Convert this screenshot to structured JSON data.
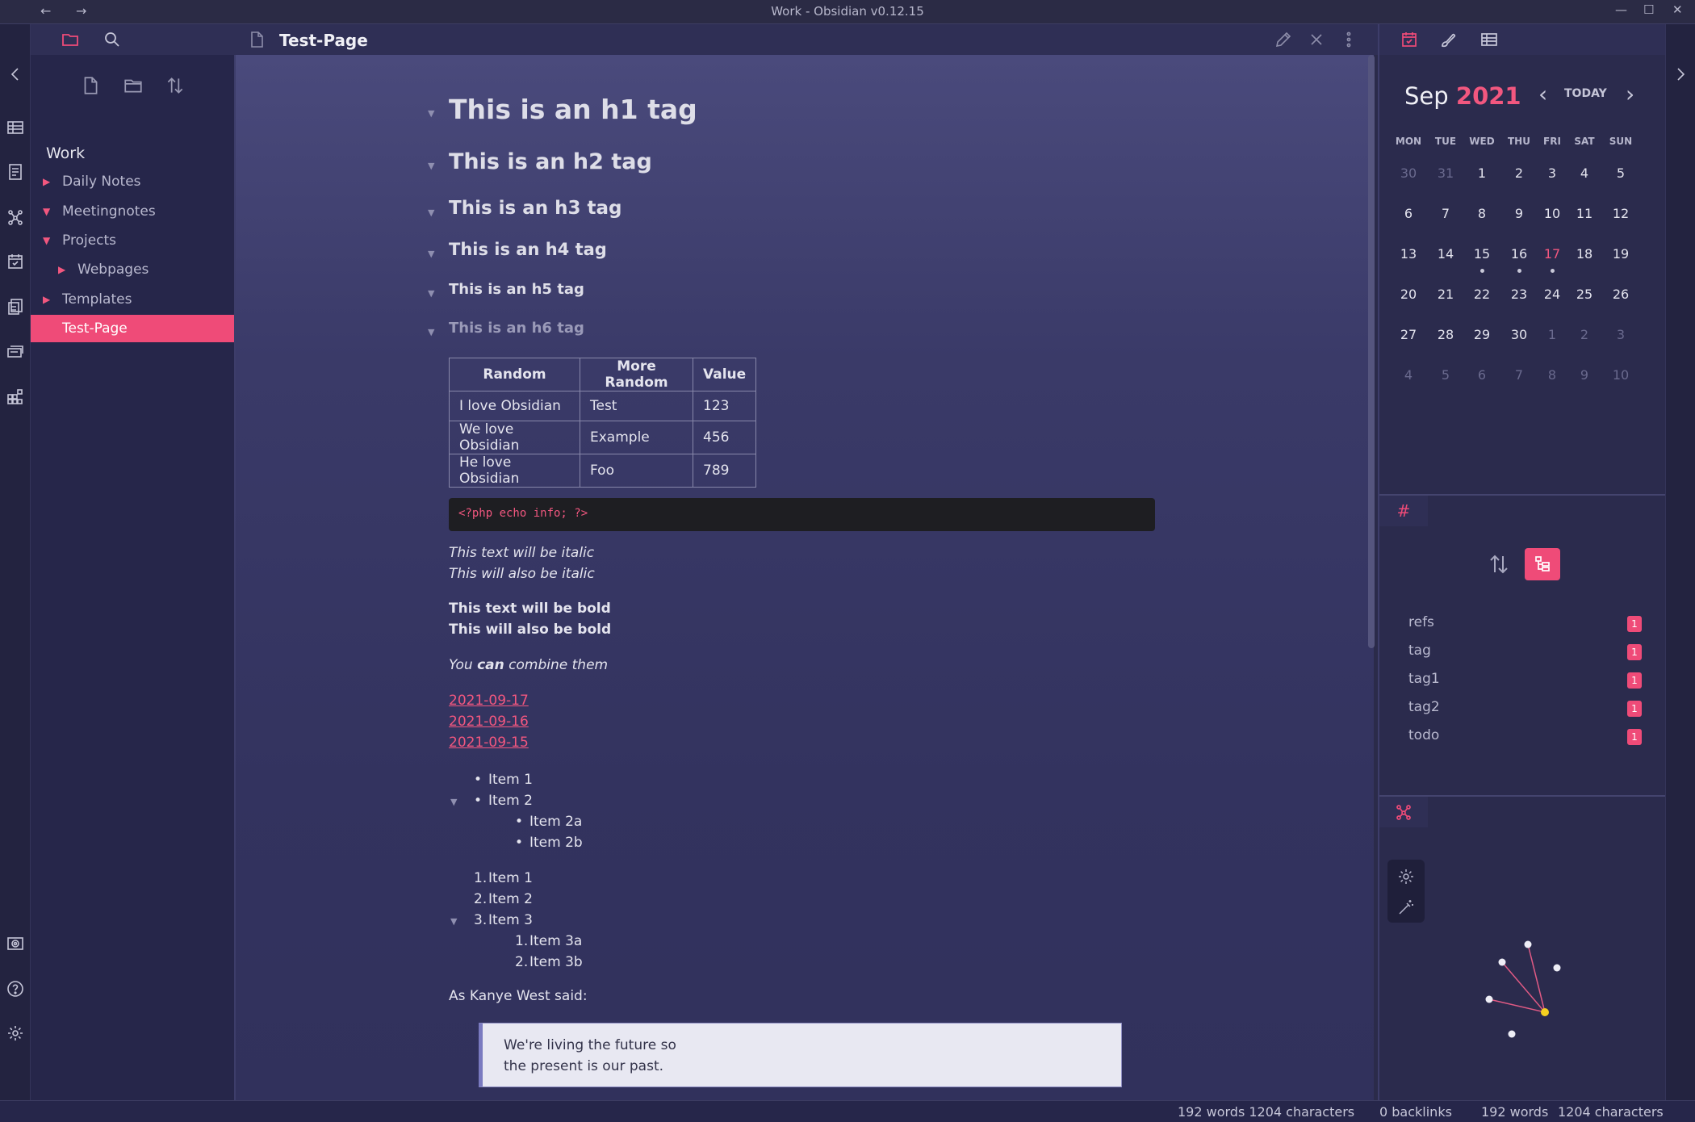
{
  "window": {
    "title": "Work - Obsidian v0.12.15",
    "back_glyph": "←",
    "forward_glyph": "→",
    "minimize_glyph": "—",
    "maximize_glyph": "☐",
    "close_glyph": "✕"
  },
  "explorer": {
    "vault_name": "Work",
    "items": [
      {
        "label": "Daily Notes",
        "arrow": "▶"
      },
      {
        "label": "Meetingnotes",
        "arrow": "▼"
      },
      {
        "label": "Projects",
        "arrow": "▼"
      },
      {
        "label": "Webpages",
        "arrow": "▶"
      },
      {
        "label": "Templates",
        "arrow": "▶"
      },
      {
        "label": "Test-Page",
        "arrow": ""
      }
    ]
  },
  "editor": {
    "file_title": "Test-Page",
    "headings": [
      "This is an h1 tag",
      "This is an h2 tag",
      "This is an h3 tag",
      "This is an h4 tag",
      "This is an h5 tag",
      "This is an h6 tag"
    ],
    "fold_glyph": "▼",
    "table": {
      "headers": [
        "Random",
        "More Random",
        "Value"
      ],
      "rows": [
        [
          "I love Obsidian",
          "Test",
          "123"
        ],
        [
          "We love Obsidian",
          "Example",
          "456"
        ],
        [
          "He love Obsidian",
          "Foo",
          "789"
        ]
      ]
    },
    "code": "<?php echo info; ?>",
    "italic_1": "This text will be italic",
    "italic_2": "This will also be italic",
    "bold_1": "This text will be bold",
    "bold_2": "This will also be bold",
    "combine_before": "You ",
    "combine_strong": "can",
    "combine_after": " combine them",
    "links": [
      "2021-09-17",
      "2021-09-16",
      "2021-09-15"
    ],
    "bullet_glyph": "•",
    "bullets": [
      "Item 1",
      "Item 2",
      "Item 2a",
      "Item 2b"
    ],
    "numbered": [
      {
        "num": "1.",
        "label": "Item 1"
      },
      {
        "num": "2.",
        "label": "Item 2"
      },
      {
        "num": "3.",
        "label": "Item 3"
      },
      {
        "num": "1.",
        "label": "Item 3a"
      },
      {
        "num": "2.",
        "label": "Item 3b"
      }
    ],
    "quote_intro": "As Kanye West said:",
    "quote_line1": "We're living the future so",
    "quote_line2": "the present is our past."
  },
  "calendar": {
    "month": "Sep",
    "year": "2021",
    "today_label": "TODAY",
    "prev_glyph": "‹",
    "next_glyph": "›",
    "weekdays": [
      "MON",
      "TUE",
      "WED",
      "THU",
      "FRI",
      "SAT",
      "SUN"
    ],
    "weeks": [
      [
        "30",
        "31",
        "1",
        "2",
        "3",
        "4",
        "5"
      ],
      [
        "6",
        "7",
        "8",
        "9",
        "10",
        "11",
        "12"
      ],
      [
        "13",
        "14",
        "15",
        "16",
        "17",
        "18",
        "19"
      ],
      [
        "20",
        "21",
        "22",
        "23",
        "24",
        "25",
        "26"
      ],
      [
        "27",
        "28",
        "29",
        "30",
        "1",
        "2",
        "3"
      ],
      [
        "4",
        "5",
        "6",
        "7",
        "8",
        "9",
        "10"
      ]
    ],
    "today": "17"
  },
  "tags": {
    "tab_glyph": "#",
    "items": [
      {
        "name": "refs",
        "count": "1"
      },
      {
        "name": "tag",
        "count": "1"
      },
      {
        "name": "tag1",
        "count": "1"
      },
      {
        "name": "tag2",
        "count": "1"
      },
      {
        "name": "todo",
        "count": "1"
      }
    ]
  },
  "status": {
    "words_chars": "192 words 1204 characters",
    "backlinks": "0 backlinks",
    "words": "192 words",
    "chars": "1204 characters"
  },
  "colors": {
    "accent": "#ef4b78",
    "background": "#2b2b4a",
    "editor_top": "#4a4a7c",
    "graph_active_node": "#f5d020"
  },
  "icons": [
    "folder-icon",
    "search-icon",
    "new-file-icon",
    "new-folder-icon",
    "sort-icon",
    "edit-icon",
    "close-icon",
    "more-icon",
    "calendar-icon",
    "graph-icon",
    "settings-icon",
    "help-icon",
    "tag-icon",
    "tree-icon",
    "magic-wand-icon"
  ]
}
